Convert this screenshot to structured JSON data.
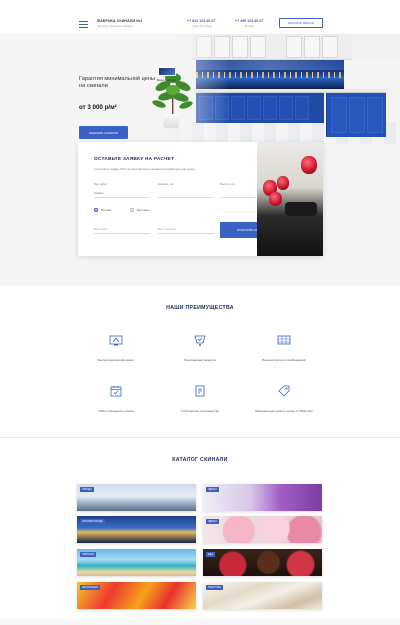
{
  "header": {
    "logo_title": "ФАБРИКА СКИНАЛИ №1",
    "logo_subtitle": "фабрика стеклянных скинали",
    "phone_1": "+7 812 123-45-67",
    "phone_1_note": "Санкт-Петербург",
    "phone_2": "+7 499 123-45-67",
    "phone_2_note": "Москва",
    "call_button": "ЗАКАЗАТЬ ЗВОНОК"
  },
  "hero": {
    "title": "Гарантия минимальной цены на скинали",
    "price": "от 3 000 р/м²",
    "order_button": "ЗАКАЗАТЬ СКИНАЛИ",
    "thumb_label": "Видео о скинали"
  },
  "form": {
    "title": "ОСТАВЬТЕ ЗАЯВКУ НА РАСЧЕТ",
    "subtitle": "и получите скидку 10% на изготовление скинали или фартука для кухни",
    "label_width": "Ширина, см",
    "label_height": "Высота, см",
    "label_type": "Вид работ",
    "type_value": "Стекло",
    "option_1": "Монтаж",
    "option_2": "Доставка",
    "name_placeholder": "Ваше имя",
    "phone_placeholder": "Ваш телефон",
    "submit_button": "ПОЛУЧИТЬ СКИДКУ"
  },
  "advantages": {
    "title": "НАШИ ПРЕИМУЩЕСТВА",
    "items": [
      {
        "icon": "designer-icon",
        "text": "Бесплатный дизайн-макет"
      },
      {
        "icon": "warranty-icon",
        "text": "Пожизненная гарантия"
      },
      {
        "icon": "catalog-icon",
        "text": "Большой каталог изображений"
      },
      {
        "icon": "calendar-icon",
        "text": "100% соблюдение сроков"
      },
      {
        "icon": "factory-icon",
        "text": "Собственное производство"
      },
      {
        "icon": "price-icon",
        "text": "Минимальная цена в городе от 3000 р/м²"
      }
    ]
  },
  "catalog": {
    "title": "КАТАЛОГ СКИНАЛИ",
    "tiles": [
      {
        "tag": "ГОРОДА"
      },
      {
        "tag": "ЦВЕТЫ"
      },
      {
        "tag": "НОЧНЫЕ ГОРОДА"
      },
      {
        "tag": "ЦВЕТЫ"
      },
      {
        "tag": "ПЕЙЗАЖИ"
      },
      {
        "tag": "ЕДА"
      },
      {
        "tag": "АБСТРАКЦИЯ"
      },
      {
        "tag": "ТЕКСТУРЫ"
      }
    ]
  }
}
